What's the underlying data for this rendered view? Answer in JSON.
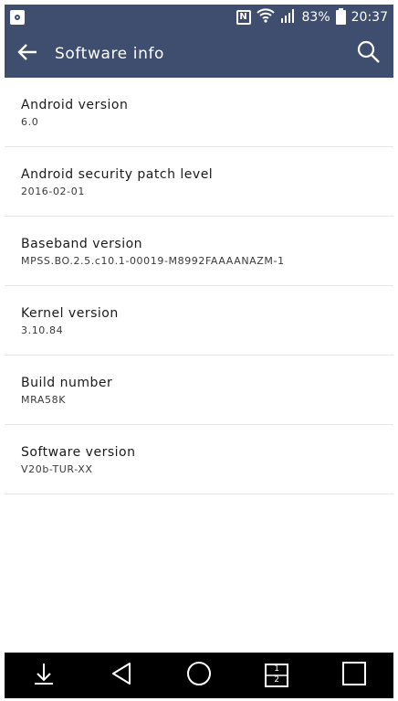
{
  "status_bar": {
    "battery_percent": "83%",
    "time": "20:37",
    "icons": [
      "q-app-icon",
      "nfc-icon",
      "wifi-icon",
      "signal-icon",
      "battery-icon"
    ]
  },
  "toolbar": {
    "title": "Software info",
    "back_icon": "arrow-left-icon",
    "search_icon": "search-icon"
  },
  "items": [
    {
      "title": "Android version",
      "value": "6.0"
    },
    {
      "title": "Android security patch level",
      "value": "2016-02-01"
    },
    {
      "title": "Baseband version",
      "value": "MPSS.BO.2.5.c10.1-00019-M8992FAAAANAZM-1"
    },
    {
      "title": "Kernel version",
      "value": "3.10.84"
    },
    {
      "title": "Build number",
      "value": "MRA58K"
    },
    {
      "title": "Software version",
      "value": "V20b-TUR-XX"
    }
  ],
  "nav_bar": {
    "icons": [
      "notification-pull-icon",
      "back-icon",
      "home-icon",
      "dual-window-icon",
      "recents-icon"
    ],
    "dual_window_label_top": "1",
    "dual_window_label_bottom": "2"
  },
  "colors": {
    "accent": "#3f4e6e",
    "nav_background": "#000000"
  }
}
